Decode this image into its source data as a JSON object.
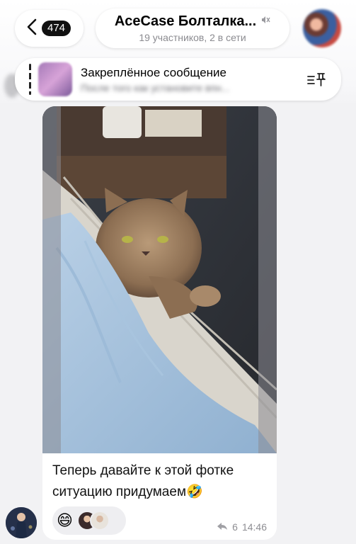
{
  "header": {
    "back_count": "474",
    "chat_title": "AceCase Болталка...",
    "chat_subtitle": "19 участников, 2 в сети"
  },
  "pinned": {
    "title": "Закреплённое сообщение",
    "preview": "После того как установите впн..."
  },
  "message": {
    "text": "Теперь давайте к этой фотке ситуацию придумаем🤣",
    "reaction_emoji": "😄",
    "reply_count": "6",
    "time": "14:46"
  },
  "colors": {
    "background": "#f2f2f4",
    "bubble": "#ffffff",
    "muted_text": "#8b8b90"
  },
  "icons": [
    "chevron-left-icon",
    "mute-icon",
    "pin-icon",
    "reply-arrow-icon"
  ]
}
